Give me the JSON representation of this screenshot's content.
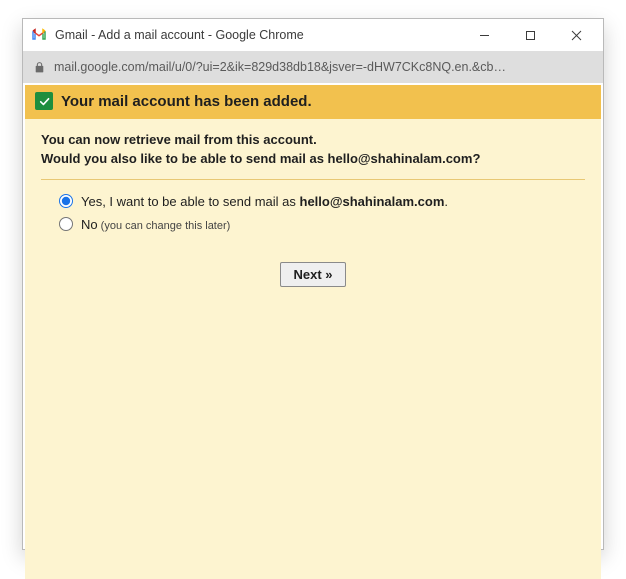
{
  "window": {
    "title": "Gmail - Add a mail account - Google Chrome"
  },
  "address_bar": {
    "url": "mail.google.com/mail/u/0/?ui=2&ik=829d38db18&jsver=-dHW7CKc8NQ.en.&cb…"
  },
  "banner": {
    "text": "Your mail account has been added."
  },
  "intro": {
    "line1": "You can now retrieve mail from this account.",
    "line2_prefix": "Would you also like to be able to send mail as ",
    "line2_email": "hello@shahinalam.com",
    "line2_suffix": "?"
  },
  "options": {
    "yes_prefix": "Yes, I want to be able to send mail as ",
    "yes_email": "hello@shahinalam.com",
    "yes_suffix": ".",
    "no_label": "No",
    "no_note": " (you can change this later)"
  },
  "buttons": {
    "next": "Next »"
  }
}
